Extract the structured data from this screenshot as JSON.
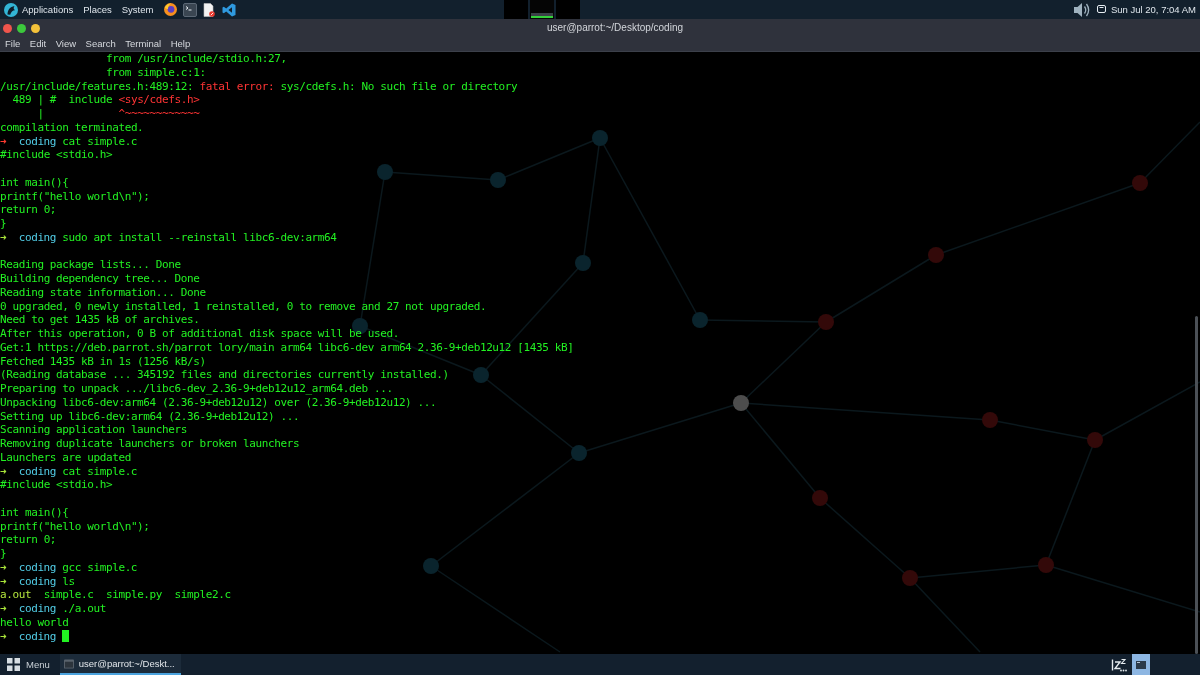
{
  "top_panel": {
    "menus": [
      "Applications",
      "Places",
      "System"
    ],
    "workspaces": [
      {
        "selected": false
      },
      {
        "selected": true
      },
      {
        "selected": false
      }
    ],
    "clock": "Sun Jul 20, 7:04 AM"
  },
  "window": {
    "title": "user@parrot:~/Desktop/coding",
    "menu": [
      "File",
      "Edit",
      "View",
      "Search",
      "Terminal",
      "Help"
    ]
  },
  "terminal": {
    "lines": [
      {
        "kind": "output",
        "segments": [
          {
            "kind": "text",
            "text": "                 from /usr/include/stdio.h:27,"
          }
        ]
      },
      {
        "kind": "output",
        "segments": [
          {
            "kind": "text",
            "text": "                 from simple.c:1:"
          }
        ]
      },
      {
        "kind": "output",
        "segments": [
          {
            "kind": "text",
            "text": "/usr/include/features.h:489:12: "
          },
          {
            "kind": "error",
            "text": "fatal error:"
          },
          {
            "kind": "text",
            "text": " sys/cdefs.h: No such file or directory"
          }
        ]
      },
      {
        "kind": "output",
        "segments": [
          {
            "kind": "text",
            "text": "  489 | #  include "
          },
          {
            "kind": "error",
            "text": "<sys/cdefs.h>"
          }
        ]
      },
      {
        "kind": "output",
        "segments": [
          {
            "kind": "text",
            "text": "      |"
          },
          {
            "kind": "error",
            "text": "            ^~~~~~~~~~~~~"
          }
        ]
      },
      {
        "kind": "output",
        "segments": [
          {
            "kind": "text",
            "text": "compilation terminated."
          }
        ]
      },
      {
        "kind": "prompt",
        "arrow": "➜",
        "failed": true,
        "dir": "coding",
        "command": "cat simple.c",
        "cursor": false
      },
      {
        "kind": "output",
        "segments": [
          {
            "kind": "text",
            "text": "#include <stdio.h>"
          }
        ]
      },
      {
        "kind": "blank"
      },
      {
        "kind": "output",
        "segments": [
          {
            "kind": "text",
            "text": "int main(){"
          }
        ]
      },
      {
        "kind": "output",
        "segments": [
          {
            "kind": "text",
            "text": "printf(\"hello world\\n\");"
          }
        ]
      },
      {
        "kind": "output",
        "segments": [
          {
            "kind": "text",
            "text": "return 0;"
          }
        ]
      },
      {
        "kind": "output",
        "segments": [
          {
            "kind": "text",
            "text": "}"
          }
        ]
      },
      {
        "kind": "prompt",
        "arrow": "➜",
        "failed": false,
        "dir": "coding",
        "command": "sudo apt install --reinstall libc6-dev:arm64",
        "cursor": false
      },
      {
        "kind": "blank"
      },
      {
        "kind": "output",
        "segments": [
          {
            "kind": "text",
            "text": "Reading package lists... Done"
          }
        ]
      },
      {
        "kind": "output",
        "segments": [
          {
            "kind": "text",
            "text": "Building dependency tree... Done"
          }
        ]
      },
      {
        "kind": "output",
        "segments": [
          {
            "kind": "text",
            "text": "Reading state information... Done"
          }
        ]
      },
      {
        "kind": "output",
        "segments": [
          {
            "kind": "text",
            "text": "0 upgraded, 0 newly installed, 1 reinstalled, 0 to remove and 27 not upgraded."
          }
        ]
      },
      {
        "kind": "output",
        "segments": [
          {
            "kind": "text",
            "text": "Need to get 1435 kB of archives."
          }
        ]
      },
      {
        "kind": "output",
        "segments": [
          {
            "kind": "text",
            "text": "After this operation, 0 B of additional disk space will be used."
          }
        ]
      },
      {
        "kind": "output",
        "segments": [
          {
            "kind": "text",
            "text": "Get:1 https://deb.parrot.sh/parrot lory/main arm64 libc6-dev arm64 2.36-9+deb12u12 [1435 kB]"
          }
        ]
      },
      {
        "kind": "output",
        "segments": [
          {
            "kind": "text",
            "text": "Fetched 1435 kB in 1s (1256 kB/s)"
          }
        ]
      },
      {
        "kind": "output",
        "segments": [
          {
            "kind": "text",
            "text": "(Reading database ... 345192 files and directories currently installed.)"
          }
        ]
      },
      {
        "kind": "output",
        "segments": [
          {
            "kind": "text",
            "text": "Preparing to unpack .../libc6-dev_2.36-9+deb12u12_arm64.deb ..."
          }
        ]
      },
      {
        "kind": "output",
        "segments": [
          {
            "kind": "text",
            "text": "Unpacking libc6-dev:arm64 (2.36-9+deb12u12) over (2.36-9+deb12u12) ..."
          }
        ]
      },
      {
        "kind": "output",
        "segments": [
          {
            "kind": "text",
            "text": "Setting up libc6-dev:arm64 (2.36-9+deb12u12) ..."
          }
        ]
      },
      {
        "kind": "output",
        "segments": [
          {
            "kind": "text",
            "text": "Scanning application launchers"
          }
        ]
      },
      {
        "kind": "output",
        "segments": [
          {
            "kind": "text",
            "text": "Removing duplicate launchers or broken launchers"
          }
        ]
      },
      {
        "kind": "output",
        "segments": [
          {
            "kind": "text",
            "text": "Launchers are updated"
          }
        ]
      },
      {
        "kind": "prompt",
        "arrow": "➜",
        "failed": false,
        "dir": "coding",
        "command": "cat simple.c",
        "cursor": false
      },
      {
        "kind": "output",
        "segments": [
          {
            "kind": "text",
            "text": "#include <stdio.h>"
          }
        ]
      },
      {
        "kind": "blank"
      },
      {
        "kind": "output",
        "segments": [
          {
            "kind": "text",
            "text": "int main(){"
          }
        ]
      },
      {
        "kind": "output",
        "segments": [
          {
            "kind": "text",
            "text": "printf(\"hello world\\n\");"
          }
        ]
      },
      {
        "kind": "output",
        "segments": [
          {
            "kind": "text",
            "text": "return 0;"
          }
        ]
      },
      {
        "kind": "output",
        "segments": [
          {
            "kind": "text",
            "text": "}"
          }
        ]
      },
      {
        "kind": "prompt",
        "arrow": "➜",
        "failed": false,
        "dir": "coding",
        "command": "gcc simple.c",
        "cursor": false
      },
      {
        "kind": "prompt",
        "arrow": "➜",
        "failed": false,
        "dir": "coding",
        "command": "ls",
        "cursor": false
      },
      {
        "kind": "output",
        "segments": [
          {
            "kind": "executable",
            "text": "a.out"
          },
          {
            "kind": "text",
            "text": "  simple.c  simple.py  simple2.c"
          }
        ]
      },
      {
        "kind": "prompt",
        "arrow": "➜",
        "failed": false,
        "dir": "coding",
        "command": "./a.out",
        "cursor": false
      },
      {
        "kind": "output",
        "segments": [
          {
            "kind": "text",
            "text": "hello world"
          }
        ]
      },
      {
        "kind": "prompt",
        "arrow": "➜",
        "failed": false,
        "dir": "coding",
        "cursor": true
      }
    ]
  },
  "taskbar": {
    "menu_label": "Menu",
    "tasks": [
      {
        "label": "user@parrot:~/Deskt...",
        "selected": true
      }
    ]
  }
}
